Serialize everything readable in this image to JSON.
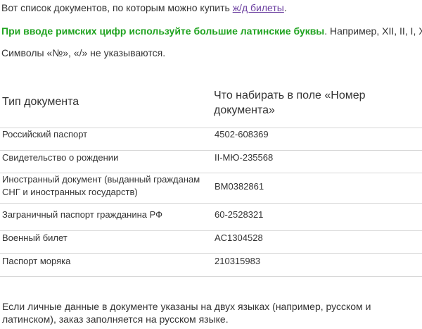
{
  "intro": {
    "text": "Вот список документов, по которым можно купить ",
    "link_text": "ж/д билеты",
    "end": "."
  },
  "roman_note": {
    "bold": "При вводе римских цифр используйте большие латинские буквы",
    "rest": ". Например, XII, II, I, X."
  },
  "symbols_note": "Символы «№», «/» не указываются.",
  "table": {
    "headers": [
      "Тип документа",
      "Что набирать в поле «Номер документа»"
    ],
    "rows": [
      {
        "type": "Российский паспорт",
        "example": "4502-608369"
      },
      {
        "type": "Свидетельство о рождении",
        "example": "II-МЮ-235568"
      },
      {
        "type": "Иностранный документ (выданный гражданам СНГ и иностранных государств)",
        "example": "BM0382861"
      },
      {
        "type": "Заграничный паспорт гражданина РФ",
        "example": "60-2528321"
      },
      {
        "type": "Военный билет",
        "example": "AC1304528"
      },
      {
        "type": "Паспорт моряка",
        "example": "210315983"
      }
    ]
  },
  "footer": "Если личные данные в документе указаны на двух языках (например, русском и латинском), заказ заполняется на русском языке.",
  "colors": {
    "text": "#333333",
    "link": "#6b3fa0",
    "highlight": "#21a321",
    "separator": "#d8d8d8"
  }
}
